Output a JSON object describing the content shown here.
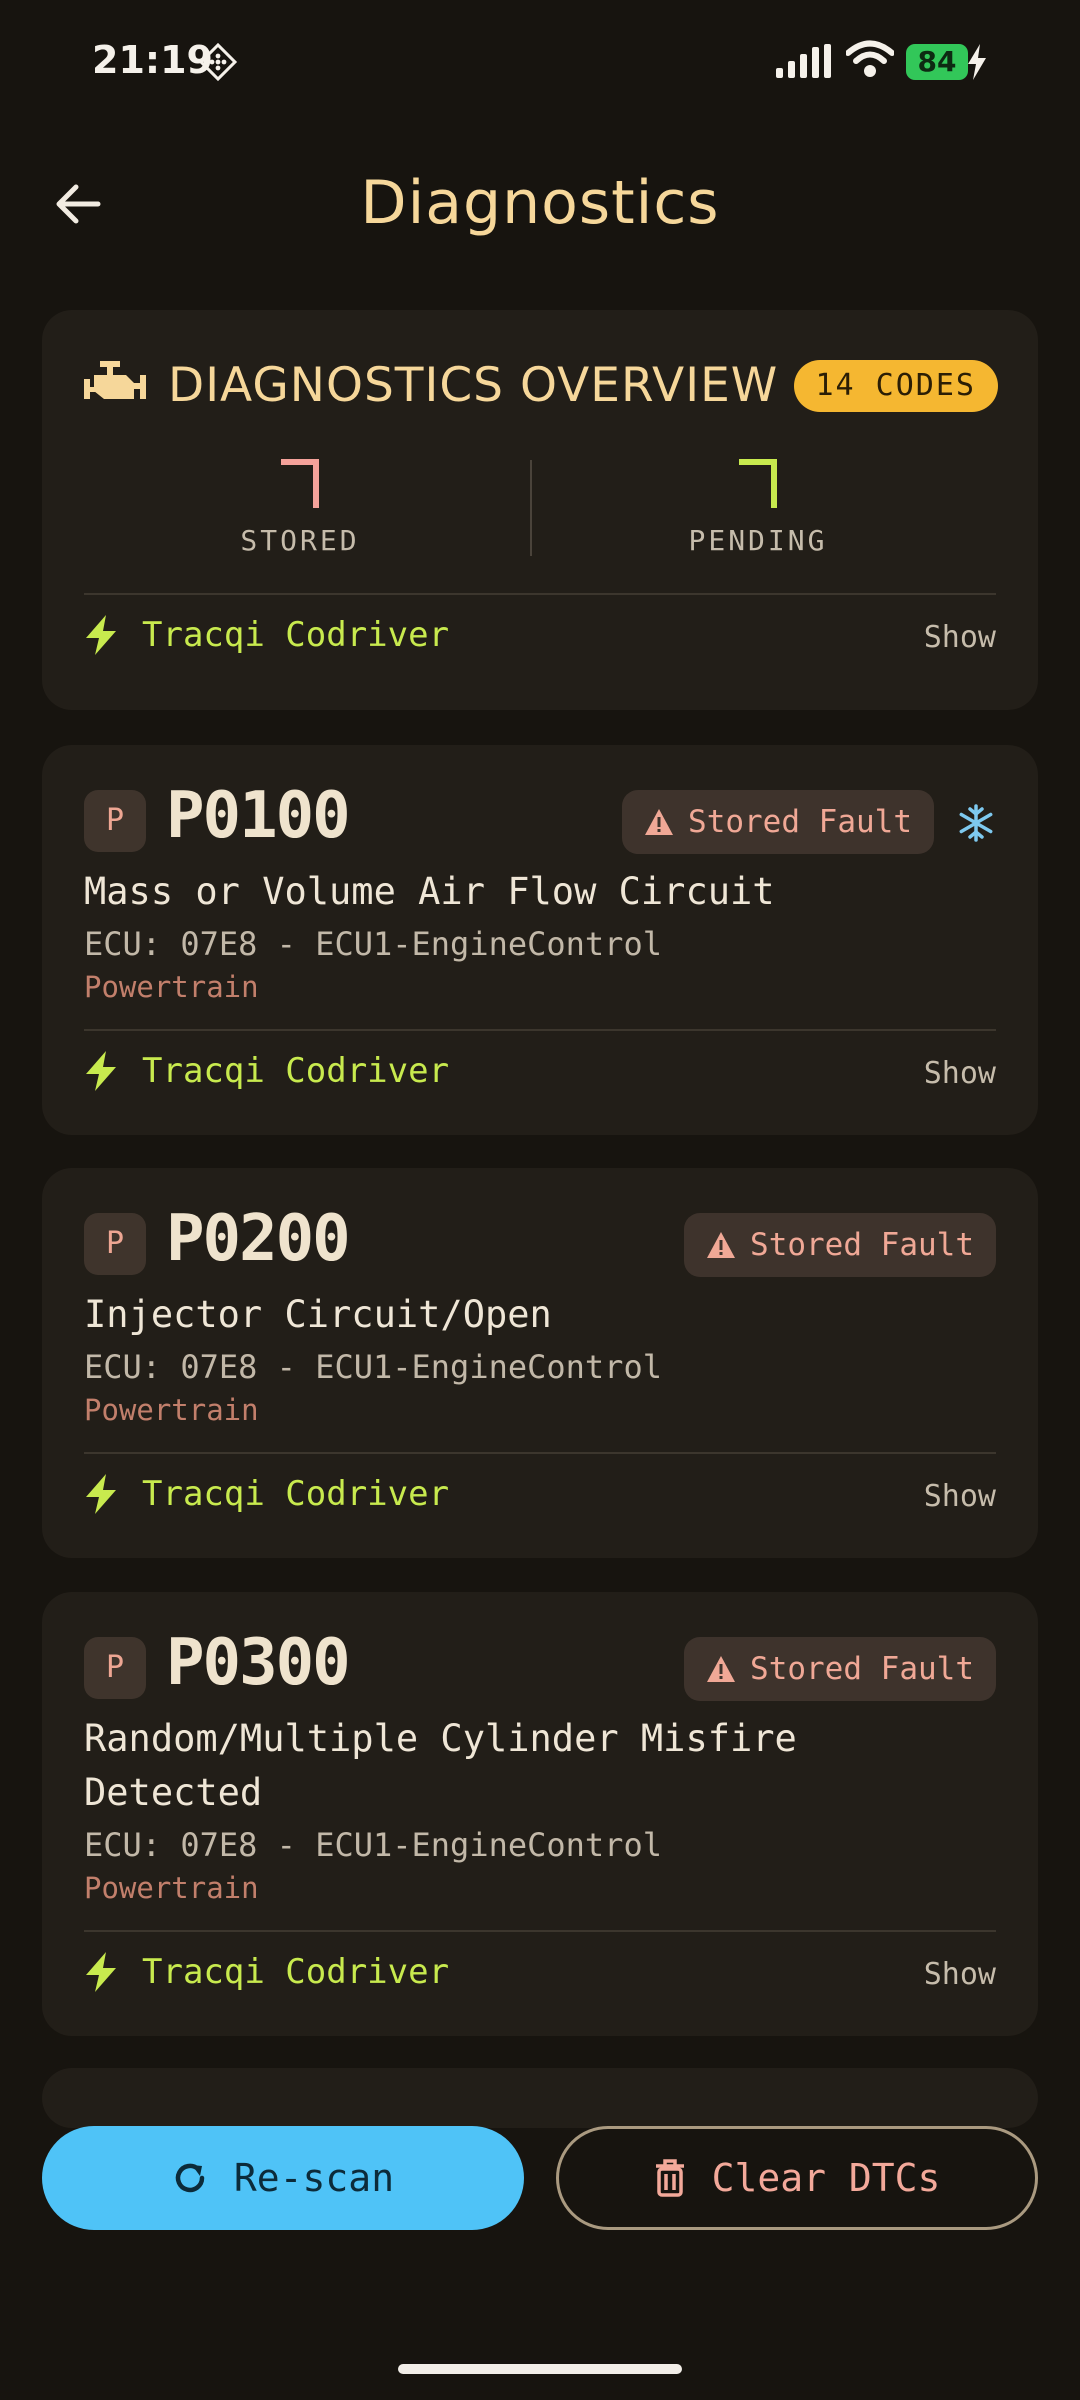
{
  "status_bar": {
    "time": "21:19",
    "battery_level": "84",
    "icons": [
      "nfc-icon",
      "signal-icon",
      "wifi-icon",
      "battery-icon",
      "charging-bolt-icon"
    ]
  },
  "header": {
    "title": "Diagnostics",
    "back_icon": "arrow-left-icon"
  },
  "overview": {
    "title": "DIAGNOSTICS OVERVIEW",
    "codes_badge": "14 CODES",
    "stored": {
      "value": "7",
      "label": "STORED",
      "color": "#f5a29a"
    },
    "pending": {
      "value": "7",
      "label": "PENDING",
      "color": "#c8ea4e"
    },
    "codriver_label": "Tracqi Codriver",
    "show_label": "Show"
  },
  "dtcs": [
    {
      "letter": "P",
      "code": "P0100",
      "status": "Stored Fault",
      "freeze_frame": true,
      "description": "Mass or Volume Air Flow Circuit",
      "ecu": "ECU: 07E8 - ECU1-EngineControl",
      "system": "Powertrain",
      "codriver_label": "Tracqi Codriver",
      "show_label": "Show"
    },
    {
      "letter": "P",
      "code": "P0200",
      "status": "Stored Fault",
      "freeze_frame": false,
      "description": "Injector Circuit/Open",
      "ecu": "ECU: 07E8 - ECU1-EngineControl",
      "system": "Powertrain",
      "codriver_label": "Tracqi Codriver",
      "show_label": "Show"
    },
    {
      "letter": "P",
      "code": "P0300",
      "status": "Stored Fault",
      "freeze_frame": false,
      "description": "Random/Multiple Cylinder Misfire Detected",
      "ecu": "ECU: 07E8 - ECU1-EngineControl",
      "system": "Powertrain",
      "codriver_label": "Tracqi Codriver",
      "show_label": "Show"
    }
  ],
  "actions": {
    "rescan_label": "Re-scan",
    "clear_label": "Clear DTCs"
  },
  "colors": {
    "background": "#17140f",
    "card": "#221e18",
    "accent_gold": "#f6d79a",
    "badge_amber": "#f5b731",
    "codriver_green": "#c8ea4e",
    "fault_red": "#f0a896",
    "rescan_blue": "#4fc3f7"
  }
}
